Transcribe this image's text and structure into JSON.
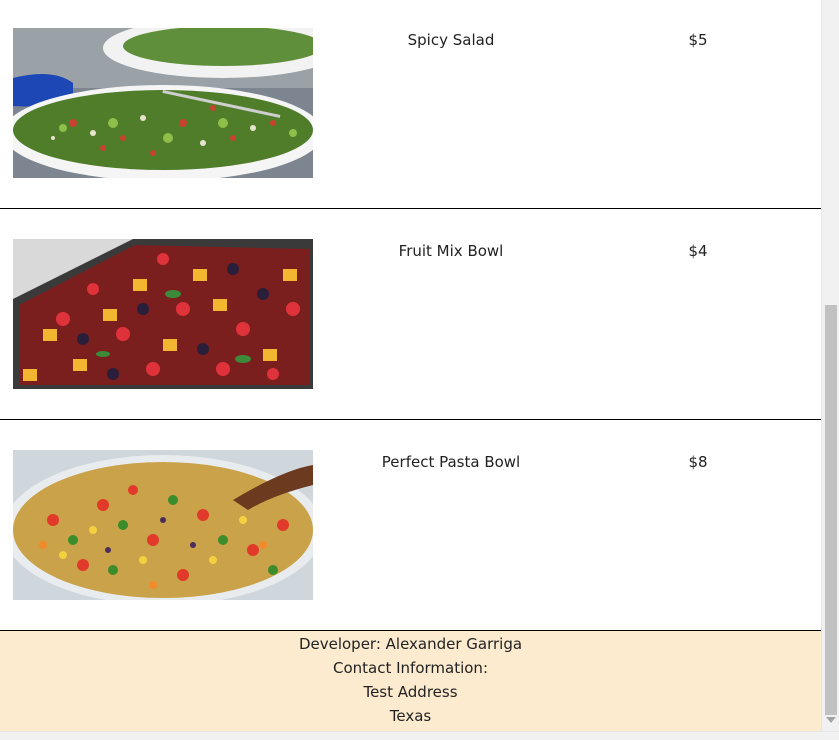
{
  "menu": {
    "items": [
      {
        "name": "Spicy Salad",
        "price": "$5",
        "image_icon": "salad-photo"
      },
      {
        "name": "Fruit Mix Bowl",
        "price": "$4",
        "image_icon": "fruit-bowl-photo"
      },
      {
        "name": "Perfect Pasta Bowl",
        "price": "$8",
        "image_icon": "pasta-bowl-photo"
      }
    ]
  },
  "footer": {
    "developer": "Developer: Alexander Garriga",
    "contact_label": "Contact Information:",
    "address": "Test Address",
    "state": "Texas",
    "background": "#fdebd0"
  }
}
